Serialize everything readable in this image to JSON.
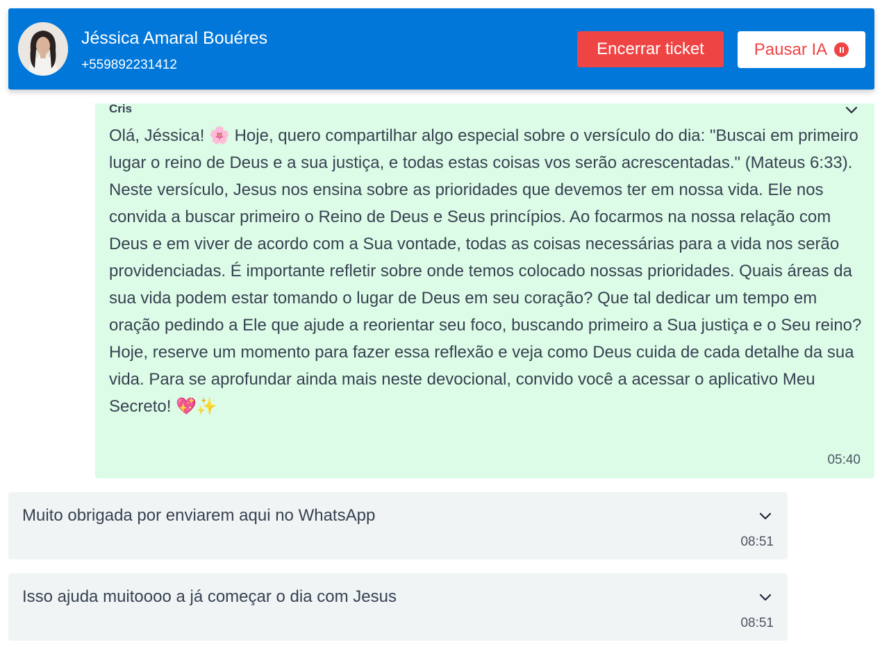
{
  "header": {
    "contact_name": "Jéssica Amaral Bouéres",
    "contact_phone": "+559892231412",
    "end_ticket_label": "Encerrar ticket",
    "pause_ai_label": "Pausar IA",
    "avatar_icon": "avatar",
    "pause_icon": "pause-circle-icon",
    "colors": {
      "header_bg": "#0077d9",
      "danger": "#ef4444"
    }
  },
  "messages": [
    {
      "direction": "outgoing",
      "sender": "Cris",
      "text": "Olá, Jéssica! 🌸 Hoje, quero compartilhar algo especial sobre o versículo do dia: \"Buscai em primeiro lugar o reino de Deus e a sua justiça, e todas estas coisas vos serão acrescentadas.\" (Mateus 6:33). Neste versículo, Jesus nos ensina sobre as prioridades que devemos ter em nossa vida. Ele nos convida a buscar primeiro o Reino de Deus e Seus princípios. Ao focarmos na nossa relação com Deus e em viver de acordo com a Sua vontade, todas as coisas necessárias para a vida nos serão providenciadas. É importante refletir sobre onde temos colocado nossas prioridades. Quais áreas da sua vida podem estar tomando o lugar de Deus em seu coração? Que tal dedicar um tempo em oração pedindo a Ele que ajude a reorientar seu foco, buscando primeiro a Sua justiça e o Seu reino? Hoje, reserve um momento para fazer essa reflexão e veja como Deus cuida de cada detalhe da sua vida. Para se aprofundar ainda mais neste devocional, convido você a acessar o aplicativo Meu Secreto! 💖✨",
      "time": "05:40",
      "bg_color": "#dcfce7"
    },
    {
      "direction": "incoming",
      "text": "Muito obrigada por enviarem aqui no WhatsApp",
      "time": "08:51",
      "bg_color": "#f0f4f5"
    },
    {
      "direction": "incoming",
      "text": "Isso ajuda muitoooo a já começar o dia com Jesus",
      "time": "08:51",
      "bg_color": "#f0f4f5"
    }
  ]
}
